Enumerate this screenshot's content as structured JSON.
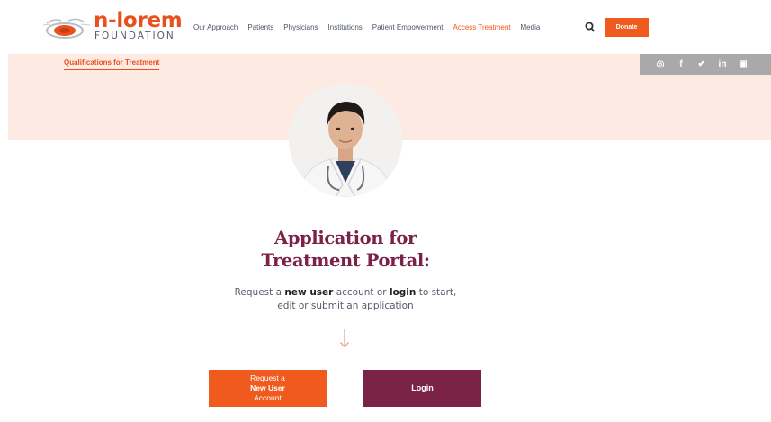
{
  "brand": {
    "name": "n-lorem",
    "subtitle": "FOUNDATION",
    "primary_color": "#f05a1e",
    "secondary_color": "#7a2248"
  },
  "nav": {
    "items": [
      {
        "label": "Our Approach",
        "active": false
      },
      {
        "label": "Patients",
        "active": false
      },
      {
        "label": "Physicians",
        "active": false
      },
      {
        "label": "Institutions",
        "active": false
      },
      {
        "label": "Patient Empowerment",
        "active": false
      },
      {
        "label": "Access Treatment",
        "active": true
      },
      {
        "label": "Media",
        "active": false
      }
    ],
    "search_icon": "search-icon",
    "donate_label": "Donate"
  },
  "hero": {
    "sub_link": "Qualifications for Treatment",
    "background": "#fdebe3",
    "social_icons": [
      "instagram-icon",
      "facebook-icon",
      "twitter-icon",
      "linkedin-icon",
      "youtube-icon"
    ],
    "social_glyphs": [
      "◎",
      "f",
      "✔",
      "in",
      "▣"
    ]
  },
  "main": {
    "title_line1": "Application for",
    "title_line2": "Treatment Portal:",
    "intro": {
      "part1": "Request a ",
      "new_user": "new user",
      "part2": " account or ",
      "login": "login",
      "part3": " to start,",
      "line2": "edit or submit an application"
    },
    "arrow_icon": "arrow-down-icon",
    "request_button": {
      "line1": "Request a",
      "bold": "New User",
      "rest": " Account"
    },
    "login_button": "Login"
  }
}
